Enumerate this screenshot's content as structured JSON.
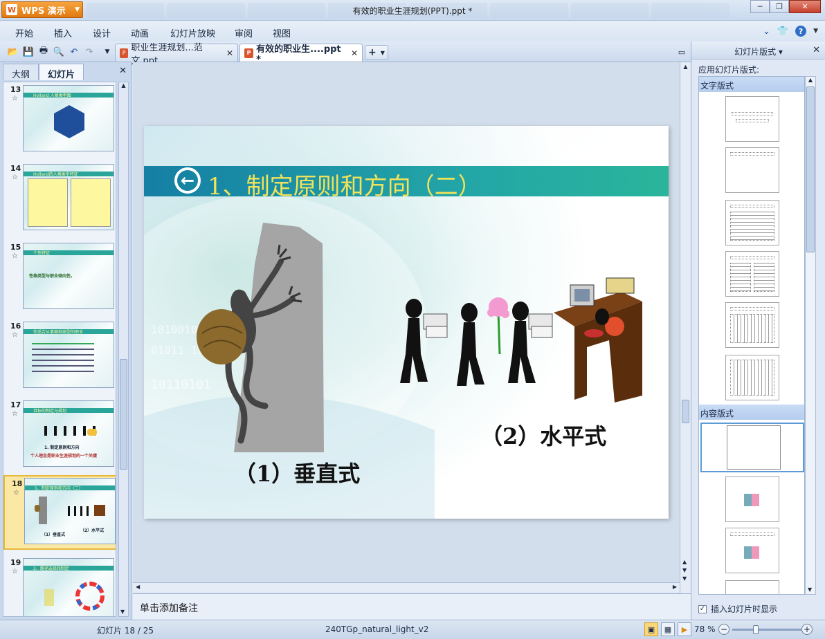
{
  "app": {
    "brand": "WPS 演示",
    "window_title": "有效的职业生涯规划(PPT).ppt *"
  },
  "menu": [
    "开始",
    "插入",
    "设计",
    "动画",
    "幻灯片放映",
    "审阅",
    "视图"
  ],
  "tabs": [
    {
      "label": "职业生涯规划...范文.ppt",
      "active": false
    },
    {
      "label": "有效的职业生....ppt *",
      "active": true
    }
  ],
  "left_panel": {
    "tabs": [
      "大纲",
      "幻灯片"
    ],
    "active_tab": "幻灯片",
    "thumbnails": [
      {
        "num": "13",
        "title": "Holland 人格类型图"
      },
      {
        "num": "14",
        "title": "Holland的人格类型特征"
      },
      {
        "num": "15",
        "title": "个性特征",
        "body": "性格类型与职业倾向性。"
      },
      {
        "num": "16",
        "title": "你适合从事哪种类型的职业"
      },
      {
        "num": "17",
        "title": "目标的制定与规划",
        "body": "1. 制定原则和方向",
        "body2": "个人理念是职业生涯规划的一个关键"
      },
      {
        "num": "18",
        "title": "1、制定原则和方向（二）",
        "cap1": "（1）垂直式",
        "cap2": "（2）水平式",
        "selected": true
      },
      {
        "num": "19",
        "title": "2、路径选择和制定"
      }
    ]
  },
  "slide": {
    "title_number": "1",
    "title": "、制定原则和方向（二）",
    "caption_vertical": "（1）垂直式",
    "caption_horizontal": "（2）水平式",
    "watermark_digits": "0101001 11010100 1011101"
  },
  "notes_placeholder": "单击添加备注",
  "right_panel": {
    "title": "幻灯片版式",
    "subtitle": "应用幻灯片版式:",
    "section_text": "文字版式",
    "section_content": "内容版式",
    "checkbox_label": "插入幻灯片时显示",
    "checkbox_checked": true
  },
  "status": {
    "slide_counter": "幻灯片 18 / 25",
    "theme": "240TGp_natural_light_v2",
    "zoom": "78 %",
    "zoom_level": 78
  },
  "colors": {
    "title_bar": "#1a8da8",
    "title_text": "#f2e35a",
    "wps_orange": "#e2821a",
    "selection": "#fbe8a5"
  }
}
